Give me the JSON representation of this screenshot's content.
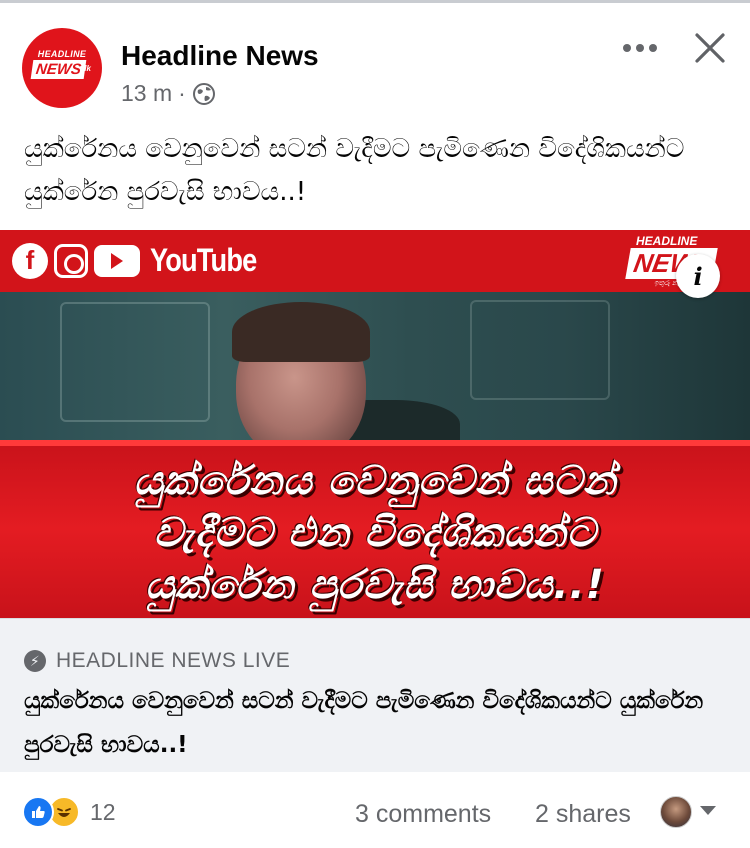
{
  "post": {
    "page_name": "Headline News",
    "time": "13 m",
    "separator": "·",
    "privacy_icon": "globe-icon",
    "caption": "යුක්රේනය වෙනුවෙන් සටන් වැදීමට පැමිණෙන විදේශිකයන්ට යුක්රේන පුරවැසි භාවය..!",
    "more_label": "•••",
    "close_label": "✕"
  },
  "avatar": {
    "top_text": "HEADLINE",
    "main_text": "NEWS",
    "sub_text": ".lk"
  },
  "media": {
    "platform_text": "YouTube",
    "brand_top": "HEADLINE",
    "brand_main": "NEW",
    "brand_sub": "ඉතුරු නැති සත්‍යය",
    "banner_lines": [
      "යුක්රේනය වෙනුවෙන් සටන්",
      "වැදීමට එන විදේශිකයන්ට",
      "යුක්රේන පුරවැසි භාවය..!"
    ],
    "info_label": "i"
  },
  "link_preview": {
    "domain": "HEADLINE NEWS LIVE",
    "title": "යුක්රේනය වෙනුවෙන් සටන් වැදීමට පැමිණෙන විදේශිකයන්ට යුක්රේන පුරවැසි භාවය..!"
  },
  "footer": {
    "reaction_count": "12",
    "comments": "3 comments",
    "shares": "2 shares"
  },
  "colors": {
    "brand_red": "#d2141a",
    "like_blue": "#1877f2",
    "muted_text": "#65676b",
    "preview_bg": "#f0f2f5"
  }
}
